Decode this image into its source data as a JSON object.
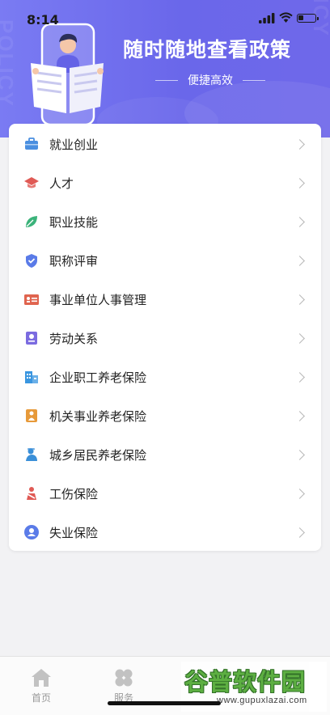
{
  "status_bar": {
    "time": "8:14"
  },
  "banner": {
    "watermark_text": "POLICY",
    "title": "随时随地查看政策",
    "subtitle": "便捷高效"
  },
  "list": {
    "items": [
      {
        "label": "就业创业",
        "icon": "briefcase-icon",
        "color": "#4a8fe0"
      },
      {
        "label": "人才",
        "icon": "graduation-cap-icon",
        "color": "#e05a55"
      },
      {
        "label": "职业技能",
        "icon": "leaf-icon",
        "color": "#3bb37a"
      },
      {
        "label": "职称评审",
        "icon": "shield-check-icon",
        "color": "#5a7be8"
      },
      {
        "label": "事业单位人事管理",
        "icon": "id-card-icon",
        "color": "#e0644f"
      },
      {
        "label": "劳动关系",
        "icon": "contract-icon",
        "color": "#7b6be0"
      },
      {
        "label": "企业职工养老保险",
        "icon": "building-icon",
        "color": "#3a96e0"
      },
      {
        "label": "机关事业养老保险",
        "icon": "suit-person-icon",
        "color": "#e79a3a"
      },
      {
        "label": "城乡居民养老保险",
        "icon": "worker-icon",
        "color": "#3a8fd8"
      },
      {
        "label": "工伤保险",
        "icon": "injured-person-icon",
        "color": "#e05a55"
      },
      {
        "label": "失业保险",
        "icon": "person-circle-icon",
        "color": "#5a7be8"
      }
    ]
  },
  "tabbar": {
    "tabs": [
      {
        "label": "首页",
        "icon": "home-icon"
      },
      {
        "label": "服务",
        "icon": "clover-icon"
      }
    ]
  },
  "watermark": {
    "title": "谷普软件园",
    "url": "www.gupuxlazai.com"
  }
}
